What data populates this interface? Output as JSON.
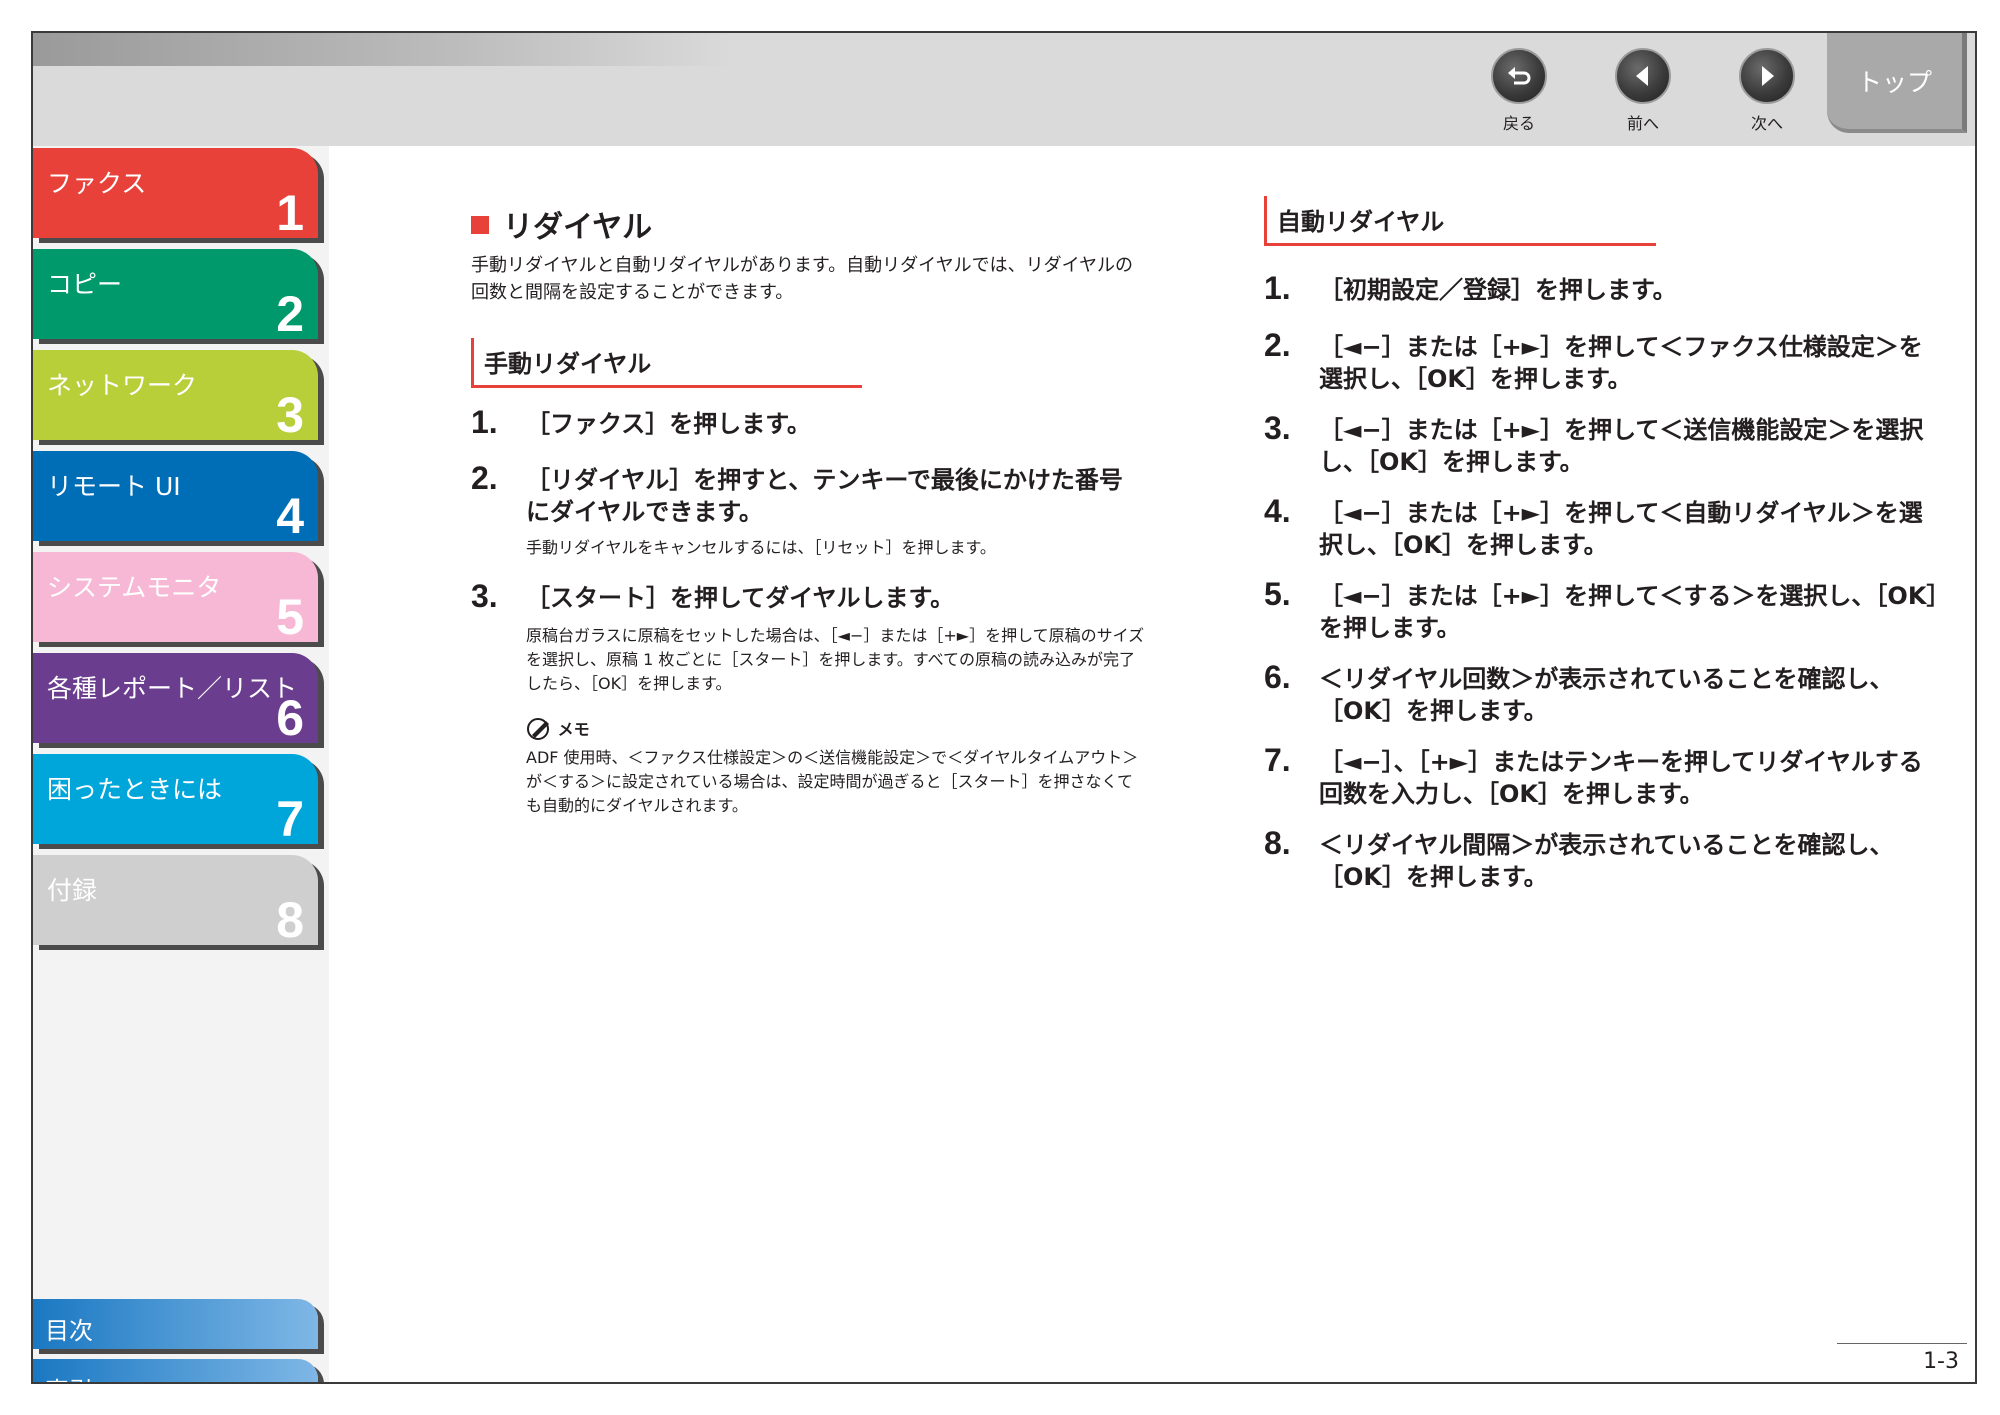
{
  "header": {
    "nav": {
      "back": "戻る",
      "prev": "前へ",
      "next": "次へ"
    },
    "top": "トップ"
  },
  "sidebar": {
    "chapters": [
      {
        "label": "ファクス",
        "number": "1",
        "color": "#e8413a"
      },
      {
        "label": "コピー",
        "number": "2",
        "color": "#00996b"
      },
      {
        "label": "ネットワーク",
        "number": "3",
        "color": "#b8cf3a"
      },
      {
        "label": "リモート UI",
        "number": "4",
        "color": "#006eb7"
      },
      {
        "label": "システムモニタ",
        "number": "5",
        "color": "#f6b8d4"
      },
      {
        "label": "各種レポート／リスト",
        "number": "6",
        "color": "#6a3d8f"
      },
      {
        "label": "困ったときには",
        "number": "7",
        "color": "#00a5d9"
      },
      {
        "label": "付録",
        "number": "8",
        "color": "#cfcfcf"
      }
    ],
    "toc": "目次",
    "index": "索引"
  },
  "content": {
    "title": "リダイヤル",
    "intro": "手動リダイヤルと自動リダイヤルがあります。自動リダイヤルでは、リダイヤルの回数と間隔を設定することができます。",
    "manual": {
      "heading": "手動リダイヤル",
      "steps": [
        {
          "num": "1.",
          "text": "［ファクス］を押します。"
        },
        {
          "num": "2.",
          "text": "［リダイヤル］を押すと、テンキーで最後にかけた番号にダイヤルできます。"
        },
        {
          "num": "3.",
          "text": "［スタート］を押してダイヤルします。"
        }
      ],
      "step2_note": "手動リダイヤルをキャンセルするには、［リセット］を押します。",
      "step3_note": "原稿台ガラスに原稿をセットした場合は、［◄−］または［+►］を押して原稿のサイズを選択し、原稿 1 枚ごとに［スタート］を押します。すべての原稿の読み込みが完了したら、［OK］を押します。",
      "memo_label": "メモ",
      "memo_text": "ADF 使用時、＜ファクス仕様設定＞の＜送信機能設定＞で＜ダイヤルタイムアウト＞が＜する＞に設定されている場合は、設定時間が過ぎると［スタート］を押さなくても自動的にダイヤルされます。"
    },
    "auto": {
      "heading": "自動リダイヤル",
      "steps": [
        {
          "num": "1.",
          "text": "［初期設定／登録］を押します。"
        },
        {
          "num": "2.",
          "text": "［◄−］または［+►］を押して＜ファクス仕様設定＞を選択し、［OK］を押します。"
        },
        {
          "num": "3.",
          "text": "［◄−］または［+►］を押して＜送信機能設定＞を選択し、［OK］を押します。"
        },
        {
          "num": "4.",
          "text": "［◄−］または［+►］を押して＜自動リダイヤル＞を選択し、［OK］を押します。"
        },
        {
          "num": "5.",
          "text": "［◄−］または［+►］を押して＜する＞を選択し、［OK］を押します。"
        },
        {
          "num": "6.",
          "text": "＜リダイヤル回数＞が表示されていることを確認し、［OK］を押します。"
        },
        {
          "num": "7.",
          "text": "［◄−］、［+►］またはテンキーを押してリダイヤルする回数を入力し、［OK］を押します。"
        },
        {
          "num": "8.",
          "text": "＜リダイヤル間隔＞が表示されていることを確認し、［OK］を押します。"
        }
      ]
    }
  },
  "page_number": "1-3"
}
